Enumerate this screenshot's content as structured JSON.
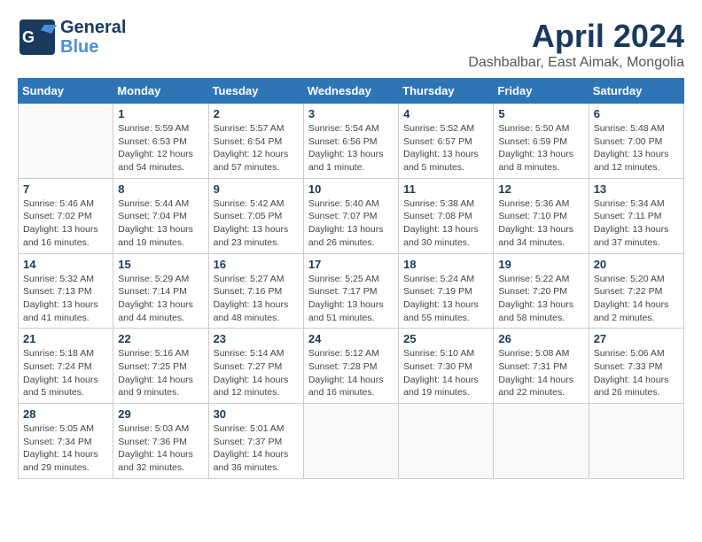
{
  "logo": {
    "line1": "General",
    "line2": "Blue"
  },
  "title": "April 2024",
  "subtitle": "Dashbalbar, East Aimak, Mongolia",
  "weekdays": [
    "Sunday",
    "Monday",
    "Tuesday",
    "Wednesday",
    "Thursday",
    "Friday",
    "Saturday"
  ],
  "weeks": [
    [
      {
        "day": "",
        "info": ""
      },
      {
        "day": "1",
        "info": "Sunrise: 5:59 AM\nSunset: 6:53 PM\nDaylight: 12 hours\nand 54 minutes."
      },
      {
        "day": "2",
        "info": "Sunrise: 5:57 AM\nSunset: 6:54 PM\nDaylight: 12 hours\nand 57 minutes."
      },
      {
        "day": "3",
        "info": "Sunrise: 5:54 AM\nSunset: 6:56 PM\nDaylight: 13 hours\nand 1 minute."
      },
      {
        "day": "4",
        "info": "Sunrise: 5:52 AM\nSunset: 6:57 PM\nDaylight: 13 hours\nand 5 minutes."
      },
      {
        "day": "5",
        "info": "Sunrise: 5:50 AM\nSunset: 6:59 PM\nDaylight: 13 hours\nand 8 minutes."
      },
      {
        "day": "6",
        "info": "Sunrise: 5:48 AM\nSunset: 7:00 PM\nDaylight: 13 hours\nand 12 minutes."
      }
    ],
    [
      {
        "day": "7",
        "info": "Sunrise: 5:46 AM\nSunset: 7:02 PM\nDaylight: 13 hours\nand 16 minutes."
      },
      {
        "day": "8",
        "info": "Sunrise: 5:44 AM\nSunset: 7:04 PM\nDaylight: 13 hours\nand 19 minutes."
      },
      {
        "day": "9",
        "info": "Sunrise: 5:42 AM\nSunset: 7:05 PM\nDaylight: 13 hours\nand 23 minutes."
      },
      {
        "day": "10",
        "info": "Sunrise: 5:40 AM\nSunset: 7:07 PM\nDaylight: 13 hours\nand 26 minutes."
      },
      {
        "day": "11",
        "info": "Sunrise: 5:38 AM\nSunset: 7:08 PM\nDaylight: 13 hours\nand 30 minutes."
      },
      {
        "day": "12",
        "info": "Sunrise: 5:36 AM\nSunset: 7:10 PM\nDaylight: 13 hours\nand 34 minutes."
      },
      {
        "day": "13",
        "info": "Sunrise: 5:34 AM\nSunset: 7:11 PM\nDaylight: 13 hours\nand 37 minutes."
      }
    ],
    [
      {
        "day": "14",
        "info": "Sunrise: 5:32 AM\nSunset: 7:13 PM\nDaylight: 13 hours\nand 41 minutes."
      },
      {
        "day": "15",
        "info": "Sunrise: 5:29 AM\nSunset: 7:14 PM\nDaylight: 13 hours\nand 44 minutes."
      },
      {
        "day": "16",
        "info": "Sunrise: 5:27 AM\nSunset: 7:16 PM\nDaylight: 13 hours\nand 48 minutes."
      },
      {
        "day": "17",
        "info": "Sunrise: 5:25 AM\nSunset: 7:17 PM\nDaylight: 13 hours\nand 51 minutes."
      },
      {
        "day": "18",
        "info": "Sunrise: 5:24 AM\nSunset: 7:19 PM\nDaylight: 13 hours\nand 55 minutes."
      },
      {
        "day": "19",
        "info": "Sunrise: 5:22 AM\nSunset: 7:20 PM\nDaylight: 13 hours\nand 58 minutes."
      },
      {
        "day": "20",
        "info": "Sunrise: 5:20 AM\nSunset: 7:22 PM\nDaylight: 14 hours\nand 2 minutes."
      }
    ],
    [
      {
        "day": "21",
        "info": "Sunrise: 5:18 AM\nSunset: 7:24 PM\nDaylight: 14 hours\nand 5 minutes."
      },
      {
        "day": "22",
        "info": "Sunrise: 5:16 AM\nSunset: 7:25 PM\nDaylight: 14 hours\nand 9 minutes."
      },
      {
        "day": "23",
        "info": "Sunrise: 5:14 AM\nSunset: 7:27 PM\nDaylight: 14 hours\nand 12 minutes."
      },
      {
        "day": "24",
        "info": "Sunrise: 5:12 AM\nSunset: 7:28 PM\nDaylight: 14 hours\nand 16 minutes."
      },
      {
        "day": "25",
        "info": "Sunrise: 5:10 AM\nSunset: 7:30 PM\nDaylight: 14 hours\nand 19 minutes."
      },
      {
        "day": "26",
        "info": "Sunrise: 5:08 AM\nSunset: 7:31 PM\nDaylight: 14 hours\nand 22 minutes."
      },
      {
        "day": "27",
        "info": "Sunrise: 5:06 AM\nSunset: 7:33 PM\nDaylight: 14 hours\nand 26 minutes."
      }
    ],
    [
      {
        "day": "28",
        "info": "Sunrise: 5:05 AM\nSunset: 7:34 PM\nDaylight: 14 hours\nand 29 minutes."
      },
      {
        "day": "29",
        "info": "Sunrise: 5:03 AM\nSunset: 7:36 PM\nDaylight: 14 hours\nand 32 minutes."
      },
      {
        "day": "30",
        "info": "Sunrise: 5:01 AM\nSunset: 7:37 PM\nDaylight: 14 hours\nand 36 minutes."
      },
      {
        "day": "",
        "info": ""
      },
      {
        "day": "",
        "info": ""
      },
      {
        "day": "",
        "info": ""
      },
      {
        "day": "",
        "info": ""
      }
    ]
  ]
}
